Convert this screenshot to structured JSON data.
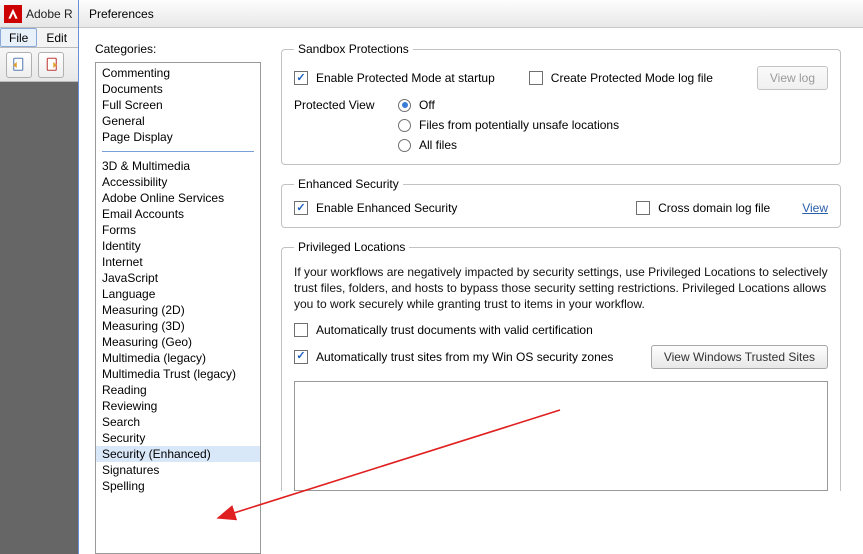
{
  "app": {
    "title": "Adobe R",
    "menu": {
      "file": "File",
      "edit": "Edit"
    }
  },
  "prefs": {
    "title": "Preferences",
    "categories_label": "Categories:",
    "categories_group1": [
      "Commenting",
      "Documents",
      "Full Screen",
      "General",
      "Page Display"
    ],
    "categories_group2": [
      "3D & Multimedia",
      "Accessibility",
      "Adobe Online Services",
      "Email Accounts",
      "Forms",
      "Identity",
      "Internet",
      "JavaScript",
      "Language",
      "Measuring (2D)",
      "Measuring (3D)",
      "Measuring (Geo)",
      "Multimedia (legacy)",
      "Multimedia Trust (legacy)",
      "Reading",
      "Reviewing",
      "Search",
      "Security",
      "Security (Enhanced)",
      "Signatures",
      "Spelling"
    ],
    "selected_category": "Security (Enhanced)",
    "sandbox": {
      "legend": "Sandbox Protections",
      "enable_pm": "Enable Protected Mode at startup",
      "enable_pm_checked": true,
      "log_file": "Create Protected Mode log file",
      "log_file_checked": false,
      "view_log": "View log",
      "protected_view_label": "Protected View",
      "pv_options": {
        "off": "Off",
        "unsafe": "Files from potentially unsafe locations",
        "all": "All files"
      },
      "pv_selected": "off"
    },
    "enhanced": {
      "legend": "Enhanced Security",
      "enable": "Enable Enhanced Security",
      "enable_checked": true,
      "cross_domain": "Cross domain log file",
      "cross_domain_checked": false,
      "view": "View"
    },
    "privileged": {
      "legend": "Privileged Locations",
      "desc": "If your workflows are negatively impacted by security settings, use Privileged Locations to selectively trust files, folders, and hosts to bypass those security setting restrictions. Privileged Locations allows you to work securely while granting trust to items in your workflow.",
      "auto_trust_cert": "Automatically trust documents with valid certification",
      "auto_trust_cert_checked": false,
      "auto_trust_zones": "Automatically trust sites from my Win OS security zones",
      "auto_trust_zones_checked": true,
      "view_sites_btn": "View Windows Trusted Sites"
    }
  }
}
